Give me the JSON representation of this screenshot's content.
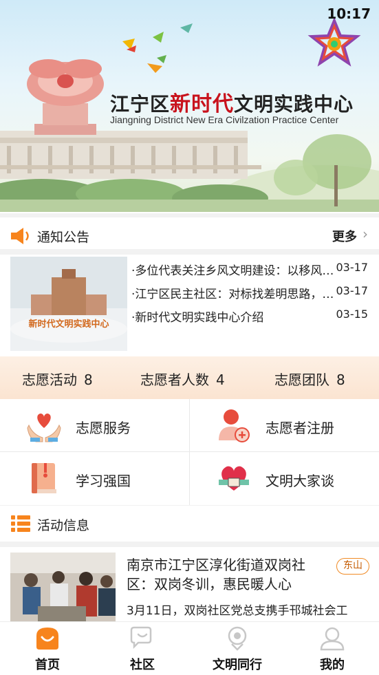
{
  "status_bar": {
    "time": "10:17"
  },
  "banner": {
    "title_prefix": "江宁区",
    "title_highlight": "新时代",
    "title_suffix": "文明实践中心",
    "subtitle": "Jiangning District New Era Civilzation Practice Center"
  },
  "notice": {
    "header_label": "通知公告",
    "more_label": "更多",
    "image_caption": "新时代文明实践中心",
    "items": [
      {
        "title": "·多位代表关注乡风文明建设：以移风易俗",
        "date": "03-17"
      },
      {
        "title": "·江宁区民主社区：对标找差明思路，凝心聚力",
        "date": "03-17"
      },
      {
        "title": "·新时代文明实践中心介绍",
        "date": "03-15"
      }
    ]
  },
  "stats": [
    {
      "label": "志愿活动",
      "value": "8"
    },
    {
      "label": "志愿者人数",
      "value": "4"
    },
    {
      "label": "志愿团队",
      "value": "8"
    }
  ],
  "grid": [
    {
      "label": "志愿服务",
      "icon": "heart-hands-icon"
    },
    {
      "label": "志愿者注册",
      "icon": "user-add-icon"
    },
    {
      "label": "学习强国",
      "icon": "book-icon"
    },
    {
      "label": "文明大家谈",
      "icon": "heart-talk-icon"
    }
  ],
  "activities": {
    "header_label": "活动信息",
    "card": {
      "title": "南京市江宁区淳化街道双岗社区：双岗冬训，惠民暖人心",
      "tag": "东山",
      "desc": "3月11日，双岗社区党总支携手邗城社会工"
    }
  },
  "tabbar": {
    "tabs": [
      {
        "label": "首页",
        "icon": "home-icon",
        "active": true
      },
      {
        "label": "社区",
        "icon": "chat-icon",
        "active": false
      },
      {
        "label": "文明同行",
        "icon": "location-icon",
        "active": false
      },
      {
        "label": "我的",
        "icon": "profile-icon",
        "active": false
      }
    ]
  },
  "colors": {
    "accent": "#f7841d",
    "banner_red": "#c8121c",
    "stats_bg": "#fbe4d1"
  }
}
